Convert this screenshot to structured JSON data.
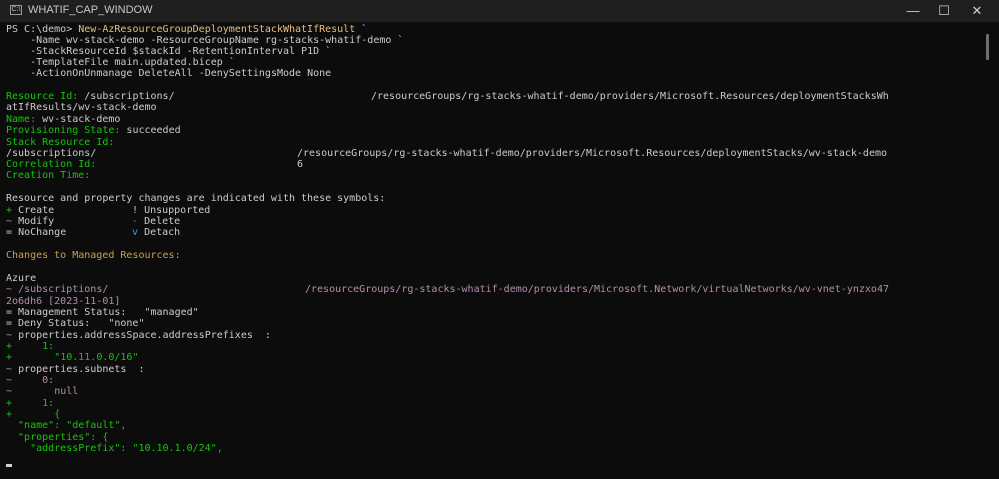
{
  "window": {
    "title": "WHATIF_CAP_WINDOW",
    "icon_text": "C:\\",
    "minimize": "—",
    "maximize": "☐",
    "close": "✕"
  },
  "command": {
    "prompt": "PS C:\\demo>",
    "cmdlet": "New-AzResourceGroupDeploymentStackWhatIfResult",
    "cont": "`",
    "l2_p1": "-Name",
    "l2_v1": "wv-stack-demo",
    "l2_p2": "-ResourceGroupName",
    "l2_v2": "rg-stacks-whatif-demo",
    "l3_p1": "-StackResourceId",
    "l3_v1": "$stackId",
    "l3_p2": "-RetentionInterval",
    "l3_v2": "P1D",
    "l4_p1": "-TemplateFile",
    "l4_v1": "main.updated.bicep",
    "l5_p1": "-ActionOnUnmanage",
    "l5_v1": "DeleteAll",
    "l5_p2": "-DenySettingsMode",
    "l5_v2": "None"
  },
  "result": {
    "resource_id_label": "Resource Id:",
    "resource_id_a": "/subscriptions/",
    "resource_id_b": "/resourceGroups/rg-stacks-whatif-demo/providers/Microsoft.Resources/deploymentStacksWh",
    "resource_id_c": "atIfResults/wv-stack-demo",
    "name_label": "Name:",
    "name_value": "wv-stack-demo",
    "prov_label": "Provisioning State:",
    "prov_value": "succeeded",
    "stack_label": "Stack Resource Id:",
    "stack_a": "/subscriptions/",
    "stack_b": "/resourceGroups/rg-stacks-whatif-demo/providers/Microsoft.Resources/deploymentStacks/wv-stack-demo",
    "corr_label": "Correlation Id:",
    "corr_value": "6",
    "creation_label": "Creation Time:"
  },
  "legend": {
    "heading": "Resource and property changes are indicated with these symbols:",
    "create_sym": "+",
    "create": "Create",
    "unsupported_sym": "!",
    "unsupported": "Unsupported",
    "modify_sym": "~",
    "modify": "Modify",
    "delete_sym": "-",
    "delete": "Delete",
    "nochange_sym": "=",
    "nochange": "NoChange",
    "detach_sym": "v",
    "detach": "Detach"
  },
  "changes": {
    "heading": "Changes to Managed Resources:",
    "scope": "Azure",
    "res_sym": "~",
    "res_a": "/subscriptions/",
    "res_b": "/resourceGroups/rg-stacks-whatif-demo/providers/Microsoft.Network/virtualNetworks/wv-vnet-ynzxo47",
    "res_c": "2o6dh6 [2023-11-01]",
    "mgmt": "= Management Status:   \"managed\"",
    "deny": "= Deny Status:   \"none\"",
    "p1_sym": "~",
    "p1": "properties.addressSpace.addressPrefixes  :",
    "p1_i_sym": "+",
    "p1_i": "1:",
    "p1_v_sym": "+",
    "p1_v": "\"10.11.0.0/16\"",
    "p2_sym": "~",
    "p2": "properties.subnets  :",
    "p2_0_sym": "~",
    "p2_0": "0:",
    "p2_0v_sym": "~",
    "p2_0v": "null",
    "p2_1_sym": "+",
    "p2_1": "1:",
    "p2_1v_sym": "+",
    "p2_1v": "{",
    "j1": "  \"name\": \"default\",",
    "j2": "  \"properties\": {",
    "j3": "    \"addressPrefix\": \"10.10.1.0/24\","
  },
  "colors": {
    "background": "#0c0c0c",
    "text": "#cccccc",
    "command": "#e5c07b",
    "parameter": "#cccccc",
    "label_green": "#16c60c",
    "modify_purple": "#b48ead",
    "detach_blue": "#3b9cdb",
    "heading_amber": "#c8a04d"
  }
}
